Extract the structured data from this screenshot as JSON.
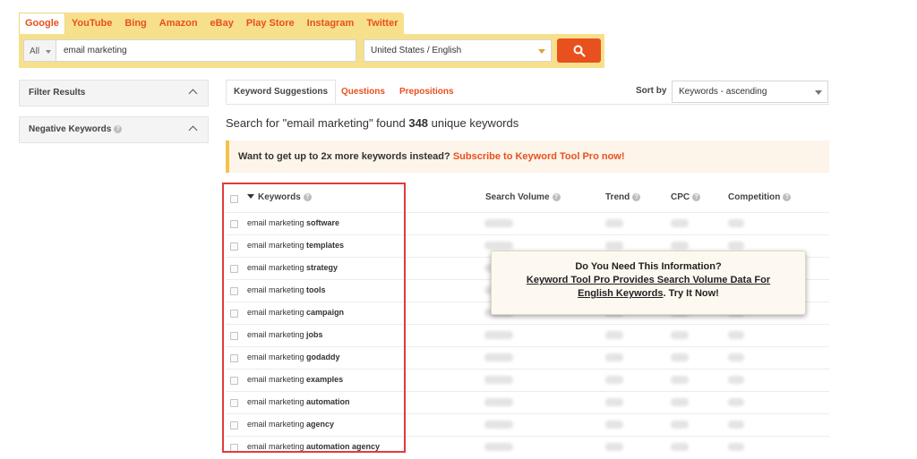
{
  "engine_tabs": [
    "Google",
    "YouTube",
    "Bing",
    "Amazon",
    "eBay",
    "Play Store",
    "Instagram",
    "Twitter"
  ],
  "search": {
    "scope": "All",
    "query": "email marketing",
    "locale": "United States / English"
  },
  "sidebar": {
    "filter_results": "Filter Results",
    "negative_keywords": "Negative Keywords"
  },
  "result_tabs": {
    "suggestions": "Keyword Suggestions",
    "questions": "Questions",
    "prepositions": "Prepositions"
  },
  "sort": {
    "label": "Sort by",
    "value": "Keywords - ascending"
  },
  "summary": {
    "prefix": "Search for \"email marketing\" found",
    "count": "348",
    "suffix": "unique keywords"
  },
  "promo": {
    "text": "Want to get up to 2x more keywords instead?",
    "link": "Subscribe to Keyword Tool Pro now!"
  },
  "table": {
    "headers": {
      "keywords": "Keywords",
      "search_volume": "Search Volume",
      "trend": "Trend",
      "cpc": "CPC",
      "competition": "Competition"
    },
    "rows": [
      {
        "base": "email marketing",
        "term": "software"
      },
      {
        "base": "email marketing",
        "term": "templates"
      },
      {
        "base": "email marketing",
        "term": "strategy"
      },
      {
        "base": "email marketing",
        "term": "tools"
      },
      {
        "base": "email marketing",
        "term": "campaign"
      },
      {
        "base": "email marketing",
        "term": "jobs"
      },
      {
        "base": "email marketing",
        "term": "godaddy"
      },
      {
        "base": "email marketing",
        "term": "examples"
      },
      {
        "base": "email marketing",
        "term": "automation"
      },
      {
        "base": "email marketing",
        "term": "agency"
      },
      {
        "base": "email marketing",
        "term": "automation agency"
      }
    ]
  },
  "popup": {
    "line1": "Do You Need This Information?",
    "line2": "Keyword Tool Pro Provides Search Volume Data For",
    "line3_link": "English Keywords",
    "line3_rest": ". Try It Now!"
  },
  "colors": {
    "accent": "#e8501e",
    "band": "#f7e08c",
    "highlight_frame": "#e03c3c"
  }
}
